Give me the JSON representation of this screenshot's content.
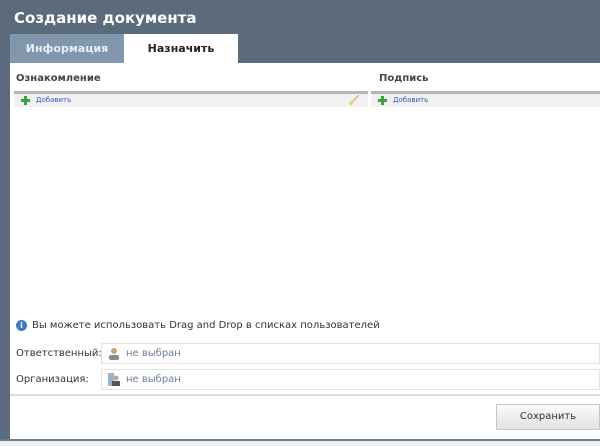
{
  "title": "Создание документа",
  "tabs": [
    {
      "label": "Информация",
      "active": false
    },
    {
      "label": "Назначить",
      "active": true
    }
  ],
  "columns": [
    {
      "header": "Ознакомление",
      "add_label": "Добавить"
    },
    {
      "header": "Подпись",
      "add_label": "Добавить"
    }
  ],
  "info_text": "Вы можете использовать Drag and Drop в списках пользователей",
  "fields": [
    {
      "label": "Ответственный:",
      "value": "не выбран"
    },
    {
      "label": "Организация:",
      "value": "не выбран"
    }
  ],
  "save_label": "Сохранить"
}
